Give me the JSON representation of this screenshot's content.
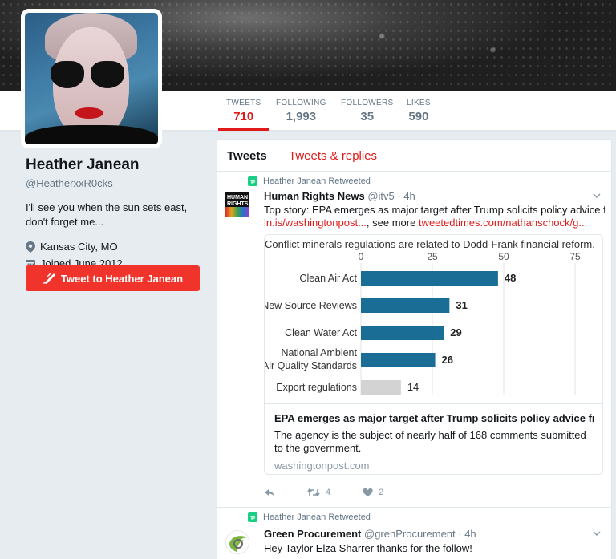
{
  "stats": [
    {
      "label": "TWEETS",
      "value": "710"
    },
    {
      "label": "FOLLOWING",
      "value": "1,993"
    },
    {
      "label": "FOLLOWERS",
      "value": "35"
    },
    {
      "label": "LIKES",
      "value": "590"
    }
  ],
  "profile": {
    "name": "Heather Janean",
    "handle": "@HeatherxxR0cks",
    "bio": "I'll see you when the sun sets east, don't forget me...",
    "location": "Kansas City, MO",
    "joined": "Joined June 2012",
    "tweet_button": "Tweet to Heather Janean"
  },
  "tabs": {
    "tweets": "Tweets",
    "replies": "Tweets & replies"
  },
  "tweets": [
    {
      "retweeted_by": "Heather Janean Retweeted",
      "author": "Human Rights News",
      "handle": "@itv5",
      "time": "· 4h",
      "text": "Top story: EPA emerges as major target after Trump solicits policy advice from ...",
      "link1": "ln.is/washingtonpost...",
      "link_mid": ", see more ",
      "link2": "tweetedtimes.com/nathanschock/g...",
      "avatar_text": "HUMAN RIGHTS",
      "card": {
        "title": "EPA emerges as major target after Trump solicits policy advice from i...",
        "description": "The agency is the subject of nearly half of 168 comments submitted to the government.",
        "domain": "washingtonpost.com"
      },
      "retweets": "4",
      "likes": "2"
    },
    {
      "retweeted_by": "Heather Janean Retweeted",
      "author": "Green Procurement",
      "handle": "@grenProcurement",
      "time": "· 4h",
      "text": "Hey Taylor Elza Sharrer thanks for the follow!"
    }
  ],
  "chart_data": {
    "type": "bar",
    "orientation": "horizontal",
    "title": "Conflict minerals regulations are related to Dodd-Frank financial reform.",
    "categories": [
      "Clean Air Act",
      "New Source Reviews",
      "Clean Water Act",
      "National Ambient Air Quality Standards",
      "Export regulations"
    ],
    "category_lines": [
      [
        "Clean Air Act"
      ],
      [
        "New Source Reviews"
      ],
      [
        "Clean Water Act"
      ],
      [
        "National Ambient",
        "Air Quality Standards"
      ],
      [
        "Export regulations"
      ]
    ],
    "values": [
      48,
      31,
      29,
      26,
      14
    ],
    "bar_colors": [
      "#1a6d94",
      "#1a6d94",
      "#1a6d94",
      "#1a6d94",
      "#d3d3d3"
    ],
    "xticks": [
      0,
      25,
      50,
      75
    ],
    "xlim": [
      0,
      75
    ],
    "grid": true
  },
  "colors": {
    "accent": "#e01a1a",
    "retweet": "#19cf86",
    "bar": "#1a6d94",
    "bar_muted": "#d3d3d3"
  }
}
